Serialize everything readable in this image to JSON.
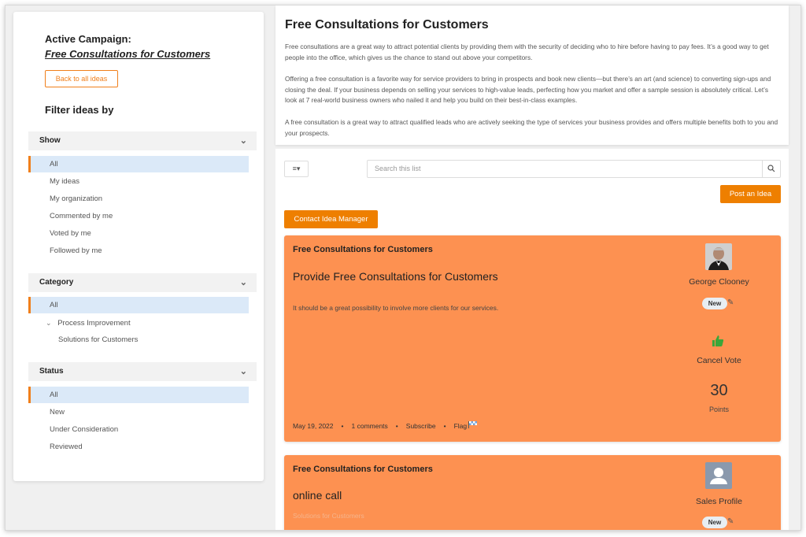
{
  "sidebar": {
    "active_campaign_label": "Active Campaign:",
    "campaign_name": "Free Consultations for Customers",
    "back_button": "Back to all ideas",
    "filter_title": "Filter ideas by",
    "show": {
      "title": "Show",
      "options": [
        "All",
        "My ideas",
        "My organization",
        "Commented by me",
        "Voted by me",
        "Followed by me"
      ]
    },
    "category": {
      "title": "Category",
      "options": [
        "All",
        "Process Improvement",
        "Solutions for Customers"
      ]
    },
    "status": {
      "title": "Status",
      "options": [
        "All",
        "New",
        "Under Consideration",
        "Reviewed"
      ]
    }
  },
  "description": {
    "title": "Free Consultations for Customers",
    "p1": "Free consultations are a great way to attract potential clients by providing them with the security of deciding who to hire before having to pay fees. It’s a good way to get people into the office, which gives us the chance to stand out above your competitors.",
    "p2": "Offering a free consultation is a favorite way for service providers to bring in prospects and book new clients—but there’s an art (and science) to converting sign-ups and closing the deal. If your business depends on selling your services to high-value leads, perfecting how you market and offer a sample session is absolutely critical. Let’s look at 7 real-world business owners who nailed it and help you build on their best-in-class examples.",
    "p3": "A free consultation is a great way to attract qualified leads who are actively seeking the type of services your business provides and offers multiple benefits both to you and your prospects."
  },
  "toolbar": {
    "search_placeholder": "Search this list",
    "post_button": "Post an Idea",
    "contact_button": "Contact Idea Manager"
  },
  "ideas": [
    {
      "campaign": "Free Consultations for Customers",
      "title": "Provide Free Consultations for Customers",
      "text": "It should be a great possibility to involve more clients for our services.",
      "author": "George Clooney",
      "status": "New",
      "vote_label": "Cancel Vote",
      "points": "30",
      "points_label": "Points",
      "date": "May 19, 2022",
      "comments": "1 comments",
      "subscribe": "Subscribe",
      "flag": "Flag"
    },
    {
      "campaign": "Free Consultations for Customers",
      "title": "online call",
      "category": "Solutions for Customers",
      "author": "Sales Profile",
      "status": "New"
    }
  ],
  "colors": {
    "accent": "#ee7f00",
    "card": "#fd9151",
    "selected": "#dbe9f8"
  }
}
